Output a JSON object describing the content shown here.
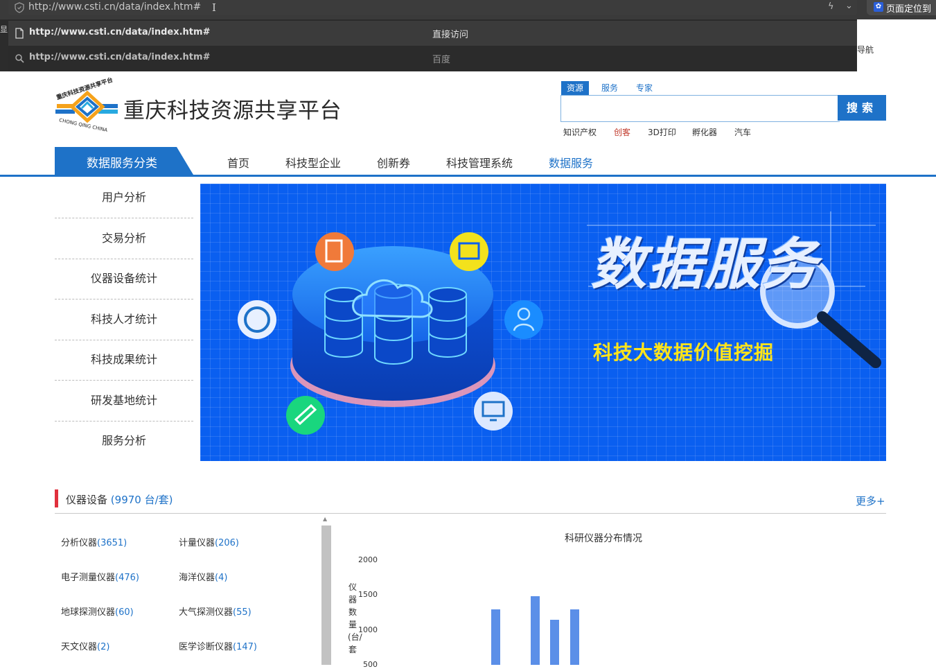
{
  "browser": {
    "url": "http://www.csti.cn/data/index.htm#",
    "extension_label": "页面定位到",
    "left_strip_char": "显",
    "behind_dropdown_text": "导航",
    "dropdown": [
      {
        "url": "http://www.csti.cn/data/index.htm#",
        "action": "直接访问"
      },
      {
        "url": "http://www.csti.cn/data/index.htm#",
        "action": "百度"
      }
    ]
  },
  "header": {
    "site_title": "重庆科技资源共享平台",
    "logo_text_top": "重庆科技资源共享平台",
    "logo_text_bottom": "CHONG QING CHINA"
  },
  "search": {
    "tabs": [
      {
        "label": "资源",
        "active": true
      },
      {
        "label": "服务",
        "active": false
      },
      {
        "label": "专家",
        "active": false
      }
    ],
    "placeholder": "",
    "button_label": "搜索",
    "hot_tags": [
      {
        "label": "知识产权",
        "highlight": false
      },
      {
        "label": "创客",
        "highlight": true
      },
      {
        "label": "3D打印",
        "highlight": false
      },
      {
        "label": "孵化器",
        "highlight": false
      },
      {
        "label": "汽车",
        "highlight": false
      }
    ]
  },
  "nav": {
    "category_label": "数据服务分类",
    "items": [
      {
        "label": "首页",
        "active": false
      },
      {
        "label": "科技型企业",
        "active": false
      },
      {
        "label": "创新券",
        "active": false
      },
      {
        "label": "科技管理系统",
        "active": false
      },
      {
        "label": "数据服务",
        "active": true
      }
    ]
  },
  "sidebar": {
    "items": [
      {
        "label": "用户分析"
      },
      {
        "label": "交易分析"
      },
      {
        "label": "仪器设备统计"
      },
      {
        "label": "科技人才统计"
      },
      {
        "label": "科技成果统计"
      },
      {
        "label": "研发基地统计"
      },
      {
        "label": "服务分析"
      }
    ]
  },
  "banner": {
    "title": "数据服务",
    "subtitle": "科技大数据价值挖掘"
  },
  "instruments": {
    "title": "仪器设备",
    "count": "(9970 台/套)",
    "more": "更多+",
    "categories": [
      {
        "name": "分析仪器",
        "count": "(3651)"
      },
      {
        "name": "计量仪器",
        "count": "(206)"
      },
      {
        "name": "电子测量仪器",
        "count": "(476)"
      },
      {
        "name": "海洋仪器",
        "count": "(4)"
      },
      {
        "name": "地球探测仪器",
        "count": "(60)"
      },
      {
        "name": "大气探测仪器",
        "count": "(55)"
      },
      {
        "name": "天文仪器",
        "count": "(2)"
      },
      {
        "name": "医学诊断仪器",
        "count": "(147)"
      }
    ]
  },
  "chart_data": {
    "type": "bar",
    "title": "科研仪器分布情况",
    "ylabel": "仪器数量(台/套",
    "yticks": [
      "2000",
      "1500",
      "1000",
      "500"
    ],
    "ylim": [
      0,
      2000
    ],
    "values": [
      1300,
      1490,
      1150,
      1300
    ],
    "bar_color": "#5b8fe8"
  },
  "colors": {
    "brand_blue": "#1e72c8",
    "accent_red": "#e0303d",
    "banner_blue": "#0a5ff0",
    "banner_yellow": "#ffe41a"
  }
}
